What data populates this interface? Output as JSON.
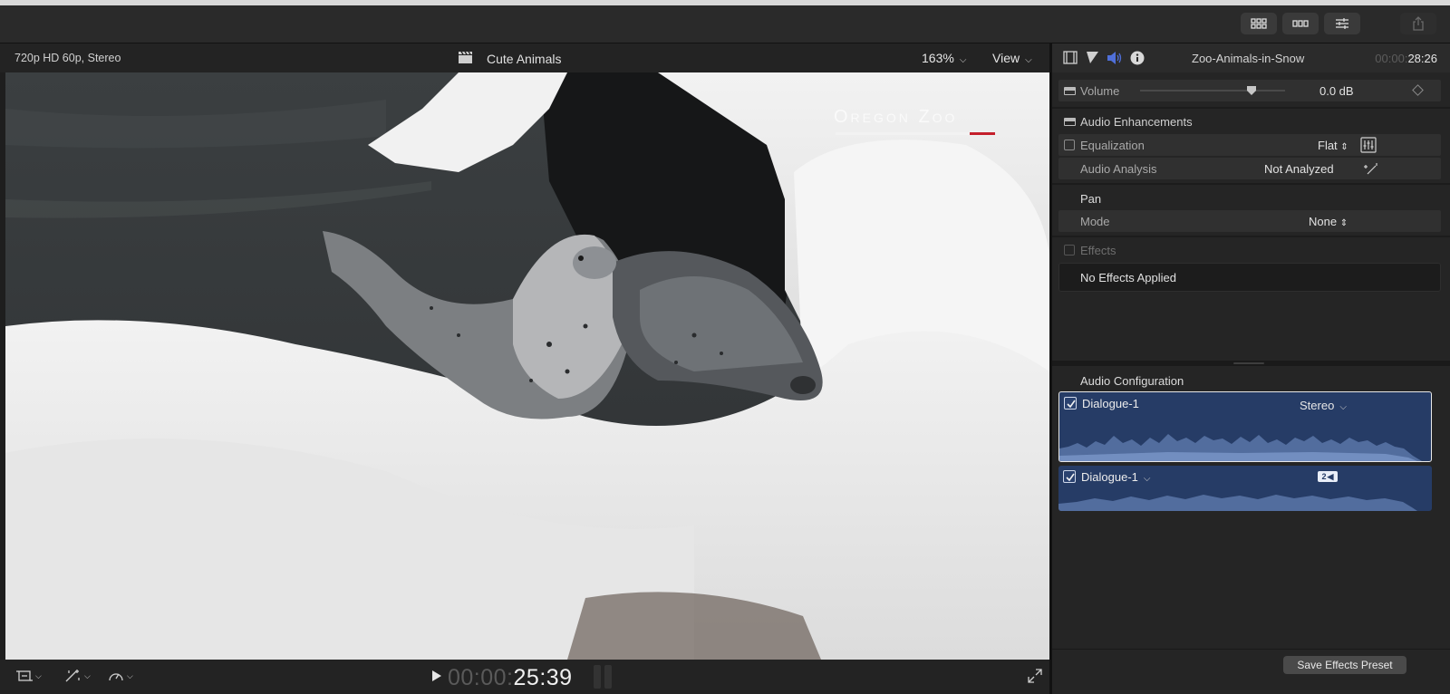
{
  "toolbar": {
    "buttons": [
      "browser-grid-icon",
      "timeline-icon",
      "inspector-sliders-icon",
      "share-icon"
    ]
  },
  "viewer": {
    "format": "720p HD 60p, Stereo",
    "project_title": "Cute Animals",
    "zoom": "163%",
    "view_label": "View",
    "watermark": "Oregon Zoo",
    "timecode_dim": "00:00:",
    "timecode_main": "25:39"
  },
  "inspector": {
    "clip_name": "Zoo-Animals-in-Snow",
    "duration_dim": "00:00:",
    "duration_main": "28:26",
    "volume": {
      "label": "Volume",
      "value": "0.0 dB",
      "level": 0.74
    },
    "audio_enhancements": {
      "label": "Audio Enhancements",
      "equalization_label": "Equalization",
      "equalization_value": "Flat",
      "analysis_label": "Audio Analysis",
      "analysis_value": "Not Analyzed"
    },
    "pan": {
      "label": "Pan",
      "mode_label": "Mode",
      "mode_value": "None"
    },
    "effects": {
      "label": "Effects",
      "empty_text": "No Effects Applied"
    },
    "audio_configuration": {
      "label": "Audio Configuration",
      "roles": [
        {
          "name": "Dialogue-1",
          "mode": "Stereo",
          "checked": true,
          "selected": true
        },
        {
          "name": "Dialogue-1",
          "badge": "2",
          "checked": true,
          "selected": false
        }
      ]
    },
    "save_preset_label": "Save Effects Preset"
  },
  "colors": {
    "role_blue": "#263c66",
    "waveform": "#5a76a8",
    "accent_volume": "#4f6fd9"
  }
}
